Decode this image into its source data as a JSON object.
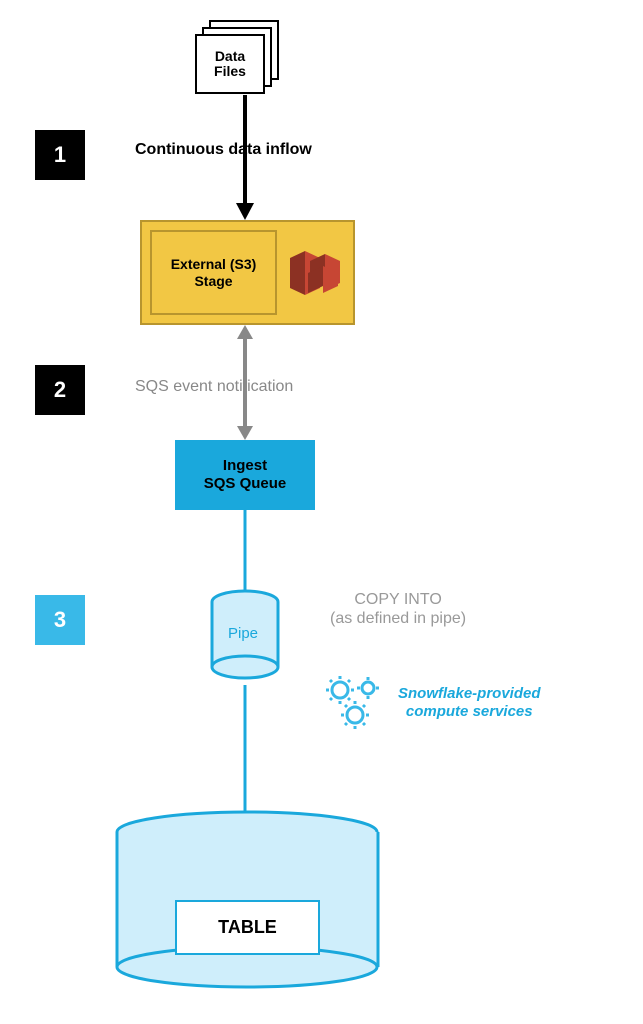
{
  "steps": {
    "s1": "1",
    "s2": "2",
    "s3": "3"
  },
  "data_files": {
    "label": "Data\nFiles"
  },
  "flows": {
    "inflow": "Continuous data inflow",
    "sqs_event": "SQS event notification",
    "copy_into_line1": "COPY INTO",
    "copy_into_line2": "(as defined in pipe)"
  },
  "s3_stage": {
    "label": "External (S3)\nStage"
  },
  "sqs_queue": {
    "label": "Ingest\nSQS Queue"
  },
  "pipe": {
    "label": "Pipe"
  },
  "compute": {
    "label": "Snowflake-provided\ncompute services"
  },
  "table": {
    "label": "TABLE"
  }
}
